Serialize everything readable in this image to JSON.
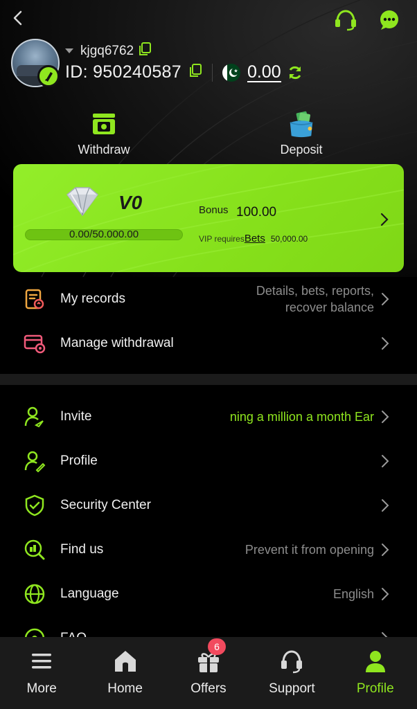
{
  "header": {
    "back_icon": "chevron-left-icon",
    "support_icon": "headset-icon",
    "chat_icon": "chat-bubble-icon",
    "username": "kjgq6762",
    "id_text": "ID: 950240587",
    "balance": "0.00",
    "currency_flag": "pakistan-flag",
    "accent": "#8fe61f"
  },
  "quick_actions": {
    "withdraw_label": "Withdraw",
    "deposit_label": "Deposit"
  },
  "vip": {
    "level": "V0",
    "progress_text": "0.00/50.000.00",
    "progress_fraction": 0,
    "bonus_label": "Bonus",
    "bonus_value": "100.00",
    "requires_label": "VIP requires",
    "bets_label": "Bets",
    "requires_amount": "50,000.00",
    "card_color": "#8fe61f"
  },
  "menu_primary": [
    {
      "label": "My records",
      "desc_line1": "Details, bets, reports,",
      "desc_line2": "recover balance",
      "icon": "records-icon"
    },
    {
      "label": "Manage withdrawal",
      "desc": "",
      "icon": "withdrawal-settings-icon"
    }
  ],
  "menu_secondary": [
    {
      "label": "Invite",
      "desc": "ning a million a month  Ear",
      "icon": "invite-user-icon"
    },
    {
      "label": "Profile",
      "desc": "",
      "icon": "profile-edit-icon"
    },
    {
      "label": "Security Center",
      "desc": "",
      "icon": "shield-check-icon"
    },
    {
      "label": "Find us",
      "desc": "Prevent it from opening",
      "icon": "find-us-icon"
    },
    {
      "label": "Language",
      "desc": "English",
      "icon": "globe-icon"
    },
    {
      "label": "FAQ",
      "desc": "",
      "icon": "faq-icon"
    }
  ],
  "bottom_nav": {
    "items": [
      {
        "label": "More",
        "icon": "menu-icon"
      },
      {
        "label": "Home",
        "icon": "home-icon"
      },
      {
        "label": "Offers",
        "icon": "gift-icon",
        "badge": "6"
      },
      {
        "label": "Support",
        "icon": "headset-icon"
      },
      {
        "label": "Profile",
        "icon": "user-icon"
      }
    ],
    "active": "Profile"
  }
}
